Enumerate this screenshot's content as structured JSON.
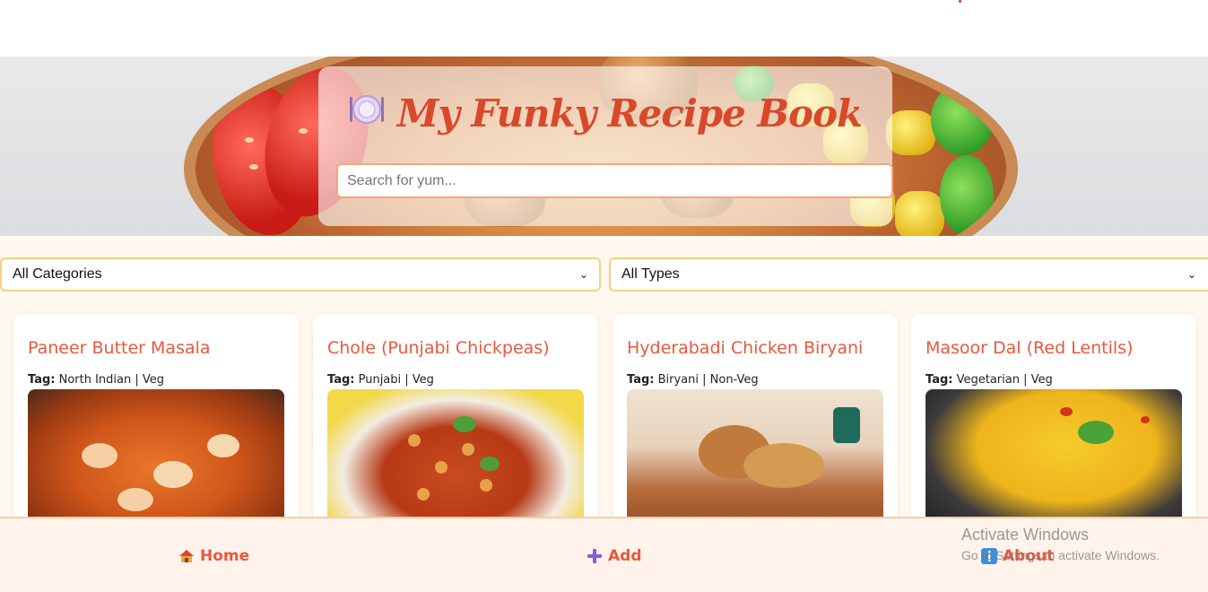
{
  "hero": {
    "title": "My Funky Recipe Book",
    "search_placeholder": "Search for yum..."
  },
  "filters": {
    "category_selected": "All Categories",
    "type_selected": "All Types"
  },
  "recipes": [
    {
      "title": "Paneer Butter Masala",
      "tag_label": "Tag:",
      "tag": "North Indian | Veg"
    },
    {
      "title": "Chole (Punjabi Chickpeas)",
      "tag_label": "Tag:",
      "tag": "Punjabi | Veg"
    },
    {
      "title": "Hyderabadi Chicken Biryani",
      "tag_label": "Tag:",
      "tag": "Biryani | Non-Veg"
    },
    {
      "title": "Masoor Dal (Red Lentils)",
      "tag_label": "Tag:",
      "tag": "Vegetarian | Veg"
    }
  ],
  "nav": {
    "home": "Home",
    "add": "Add",
    "about": "About"
  },
  "watermark": {
    "line1": "Activate Windows",
    "line2": "Go to Settings to activate Windows."
  },
  "colors": {
    "accent": "#e9583c",
    "background": "#fff9ef",
    "border": "#f3cf86"
  },
  "icons": {
    "hero": "plate-cutlery-icon",
    "home": "house-icon",
    "add": "plus-icon",
    "about": "info-icon"
  }
}
